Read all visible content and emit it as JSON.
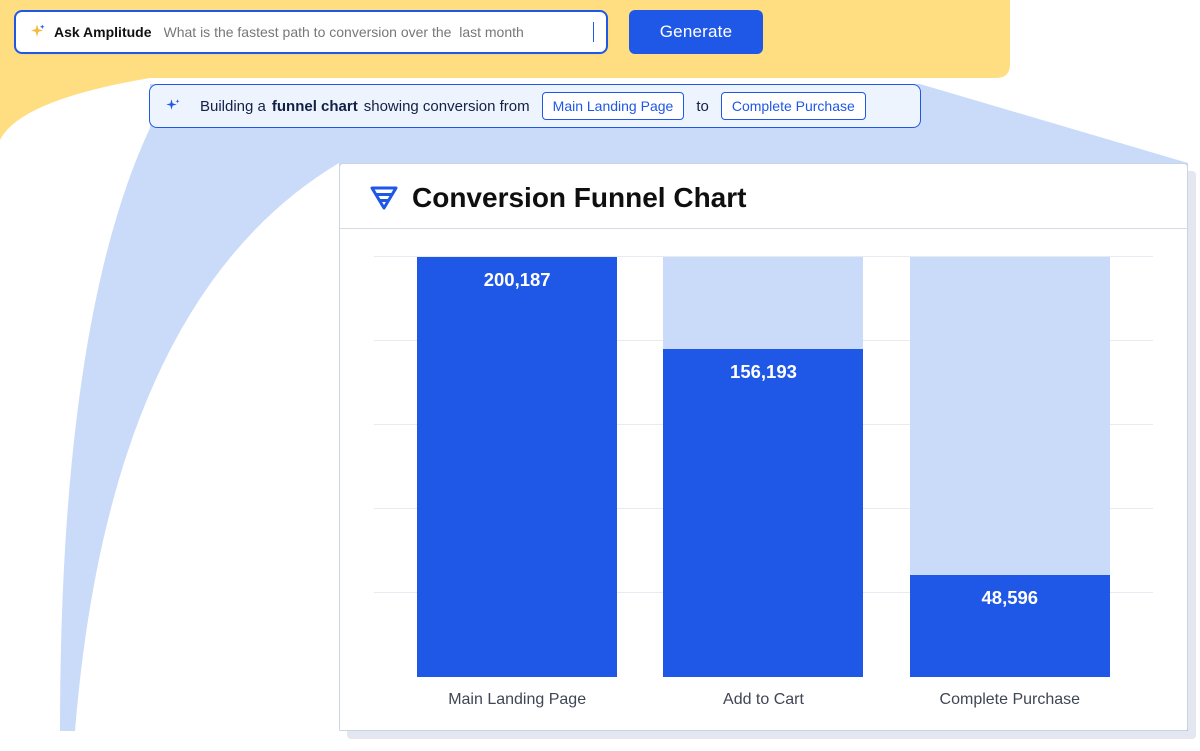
{
  "ask": {
    "label": "Ask Amplitude",
    "query": "What is the fastest path to conversion over the  last month"
  },
  "generate": {
    "label": "Generate"
  },
  "building": {
    "prefix": "Building a ",
    "bold": "funnel chart",
    "mid": " showing conversion from",
    "chip_from": "Main Landing Page",
    "to": "to",
    "chip_to": "Complete Purchase"
  },
  "chart": {
    "title": "Conversion Funnel Chart"
  },
  "chart_data": {
    "type": "bar",
    "categories": [
      "Main Landing Page",
      "Add to Cart",
      "Complete Purchase"
    ],
    "values": [
      200187,
      156193,
      48596
    ],
    "value_labels": [
      "200,187",
      "156,193",
      "48,596"
    ],
    "baseline": 200187,
    "title": "Conversion Funnel Chart",
    "xlabel": "",
    "ylabel": "",
    "ylim": [
      0,
      200187
    ],
    "grid_count": 5,
    "colors": {
      "fg": "#1F57E7",
      "bg": "#CADBF9"
    }
  }
}
